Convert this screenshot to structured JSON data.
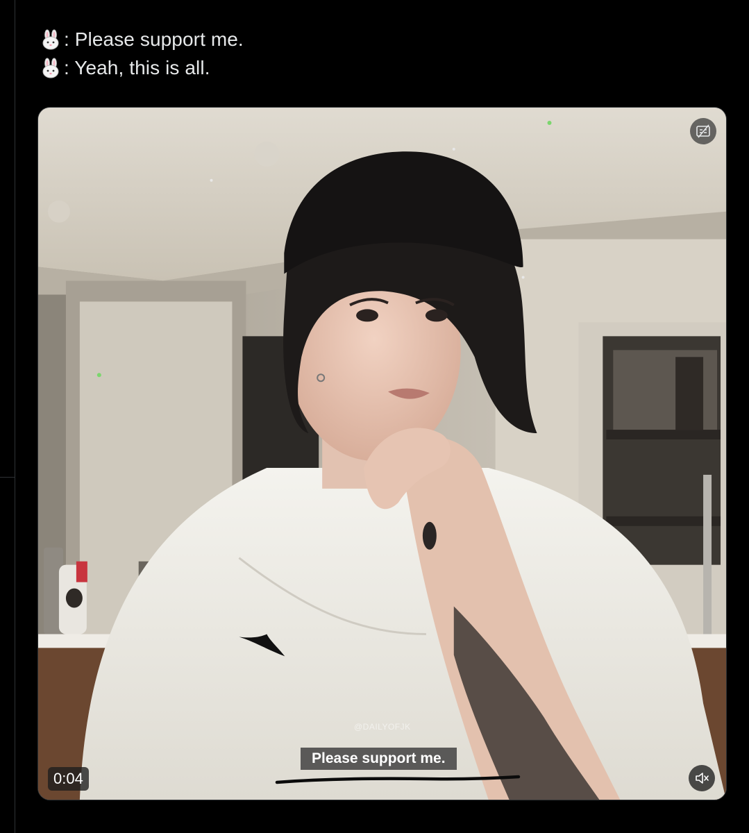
{
  "tweet": {
    "lines": [
      {
        "emoji": "rabbit-face-icon",
        "text": ": Please support me."
      },
      {
        "emoji": "rabbit-face-icon",
        "text": ": Yeah, this is all."
      }
    ]
  },
  "video": {
    "timestamp": "0:04",
    "subtitle": "Please support me.",
    "watermark": "@DAILYOFJK",
    "caption_icon": "captions-off-icon",
    "mute_icon": "speaker-muted-icon"
  },
  "colors": {
    "background": "#000000",
    "text": "#e7e9ea",
    "border": "#2f3336"
  }
}
